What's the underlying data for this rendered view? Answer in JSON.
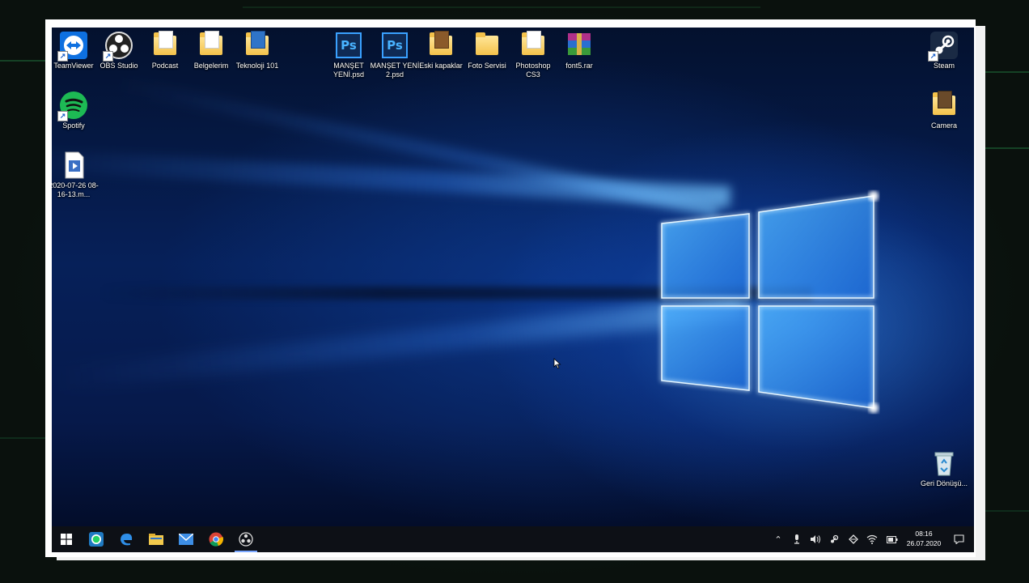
{
  "desktop": {
    "icons": [
      {
        "label": "TeamViewer",
        "icon": "teamviewer-icon"
      },
      {
        "label": "OBS Studio",
        "icon": "obs-icon"
      },
      {
        "label": "Podcast",
        "icon": "folder-icon"
      },
      {
        "label": "Belgelerim",
        "icon": "folder-icon"
      },
      {
        "label": "Teknoloji 101",
        "icon": "folder-icon"
      },
      {
        "label": "MANŞET YENİ.psd",
        "icon": "photoshop-file-icon"
      },
      {
        "label": "MANŞET YENİ 2.psd",
        "icon": "photoshop-file-icon"
      },
      {
        "label": "Eski kapaklar",
        "icon": "folder-icon"
      },
      {
        "label": "Foto Servisi",
        "icon": "folder-icon"
      },
      {
        "label": "Photoshop CS3",
        "icon": "folder-icon"
      },
      {
        "label": "font5.rar",
        "icon": "winrar-icon"
      },
      {
        "label": "Spotify",
        "icon": "spotify-icon"
      },
      {
        "label": "2020-07-26 08-16-13.m...",
        "icon": "video-file-icon"
      },
      {
        "label": "Steam",
        "icon": "steam-icon"
      },
      {
        "label": "Camera",
        "icon": "folder-icon"
      },
      {
        "label": "Geri Dönüşü...",
        "icon": "recycle-bin-icon"
      }
    ]
  },
  "taskbar": {
    "pinned": [
      {
        "name": "start",
        "icon": "windows-start-icon"
      },
      {
        "name": "whatsapp",
        "icon": "whatsapp-icon"
      },
      {
        "name": "edge",
        "icon": "edge-icon"
      },
      {
        "name": "file-explorer",
        "icon": "file-explorer-icon"
      },
      {
        "name": "mail",
        "icon": "mail-icon"
      },
      {
        "name": "chrome",
        "icon": "chrome-icon"
      },
      {
        "name": "obs",
        "icon": "obs-icon"
      }
    ],
    "tray": {
      "time": "08:16",
      "date": "26.07.2020"
    }
  },
  "colors": {
    "accent": "#3aa1ff",
    "taskbar": "#0d1016",
    "frame": "#ffffff"
  }
}
